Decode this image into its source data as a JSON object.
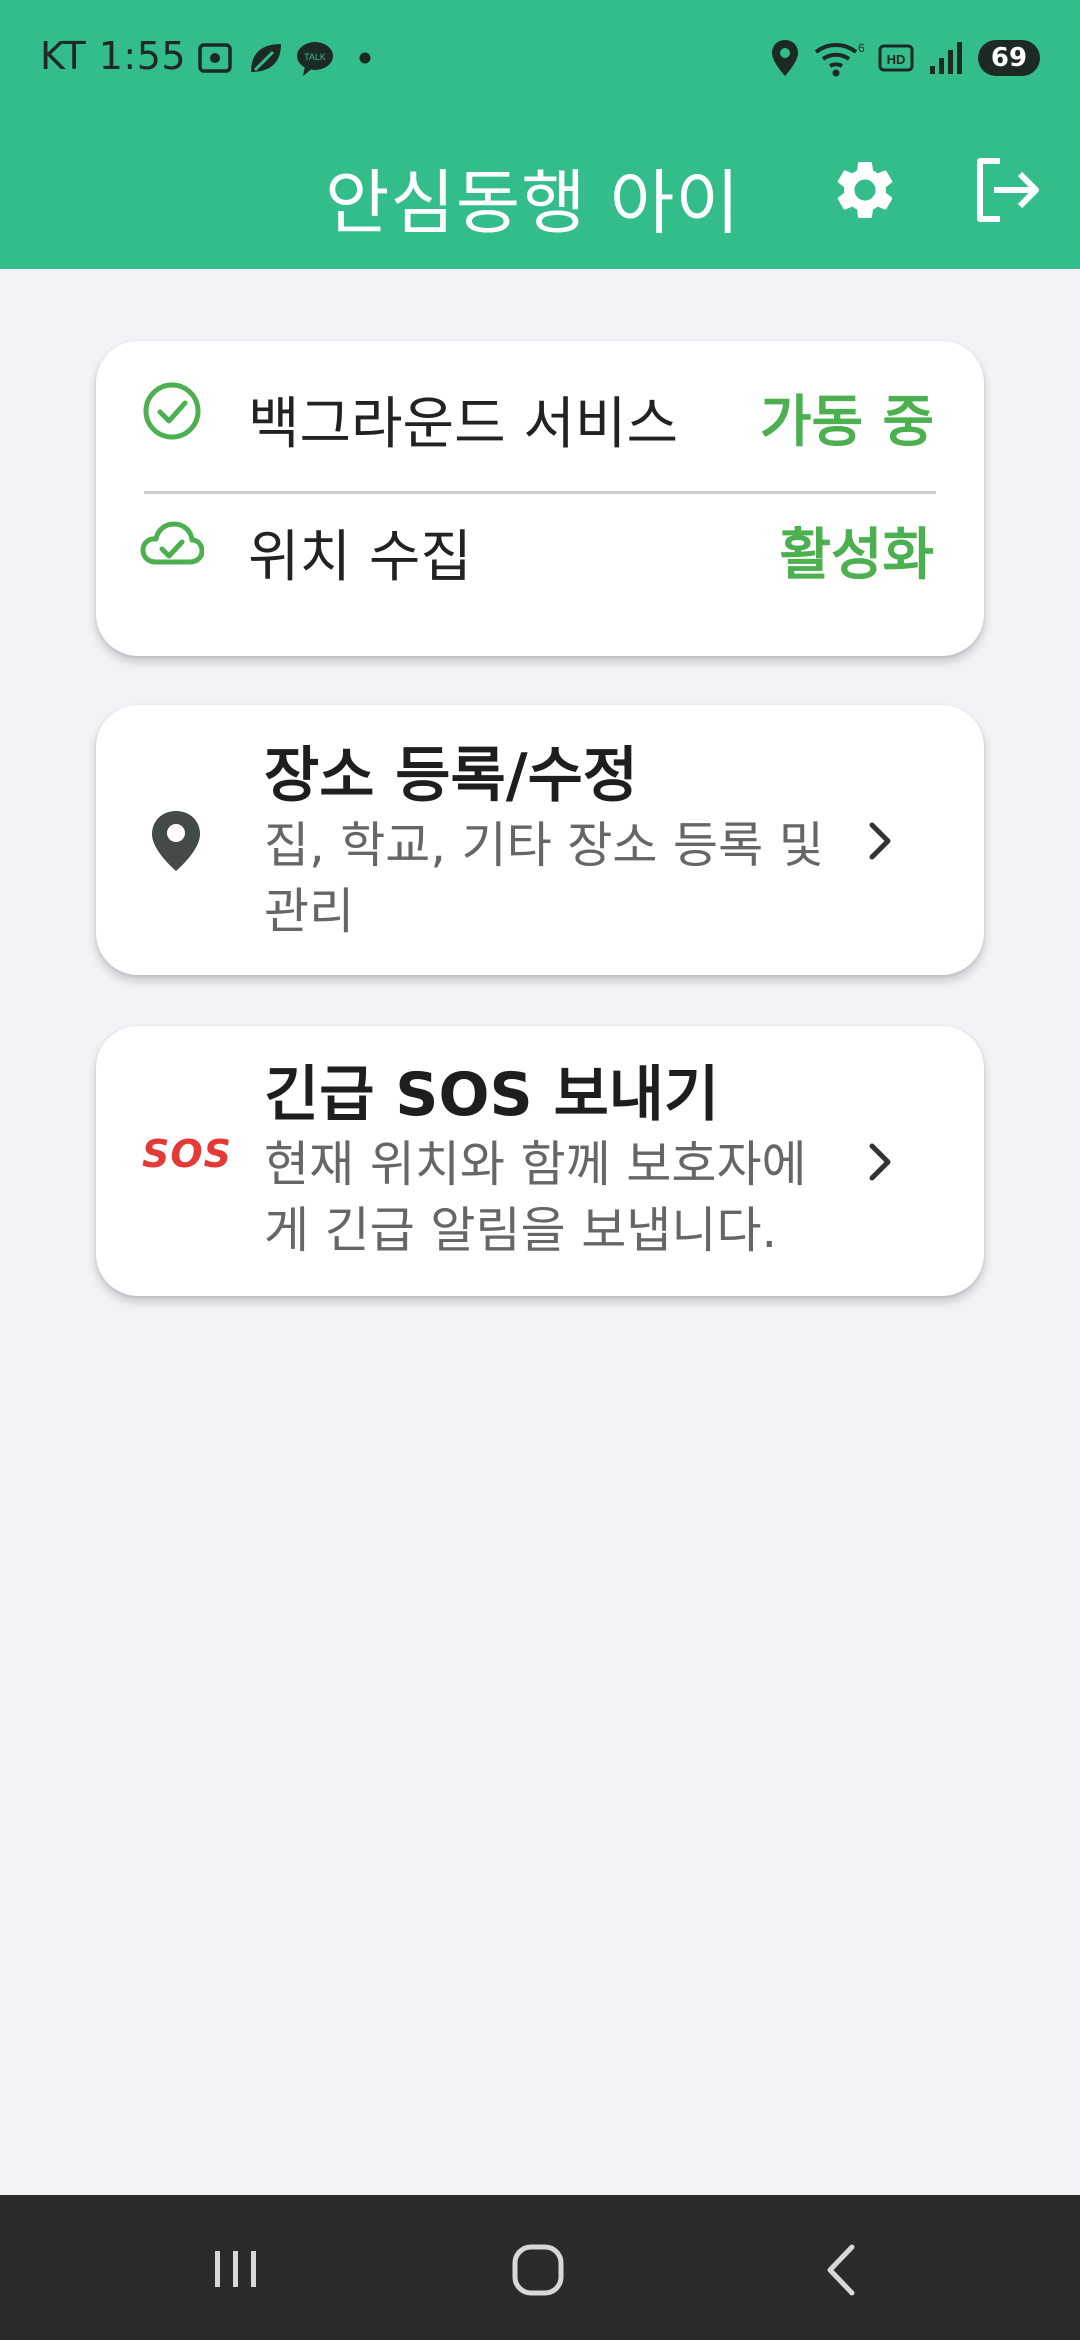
{
  "status_bar": {
    "carrier_time": "KT 1:55",
    "battery": "69",
    "icons_left": [
      "screenshot-icon",
      "leaf-icon",
      "talk-icon",
      "dot-icon"
    ],
    "icons_right": [
      "location-icon",
      "wifi-icon",
      "hd-icon",
      "signal-icon",
      "battery-icon"
    ]
  },
  "app_bar": {
    "title": "안심동행 아이",
    "actions": [
      "gear-icon",
      "logout-icon"
    ]
  },
  "status_card": {
    "rows": [
      {
        "icon": "check-circle-icon",
        "label": "백그라운드 서비스",
        "value": "가동 중"
      },
      {
        "icon": "cloud-check-icon",
        "label": "위치 수집",
        "value": "활성화"
      }
    ],
    "accent_color": "#4caf50"
  },
  "actions": {
    "place": {
      "icon": "location-pin-icon",
      "title": "장소 등록/수정",
      "description": "집, 학교, 기타 장소 등록 및 관리"
    },
    "sos": {
      "icon_text": "SOS",
      "title": "긴급 SOS 보내기",
      "description": "현재 위치와 함께 보호자에게 긴급 알림을 보냅니다."
    }
  },
  "nav_bar": {
    "buttons": [
      "recent-apps-icon",
      "home-icon",
      "back-icon"
    ]
  },
  "colors": {
    "primary": "#33bd8a",
    "background": "#f2f3f7",
    "sos": "#e53935"
  }
}
